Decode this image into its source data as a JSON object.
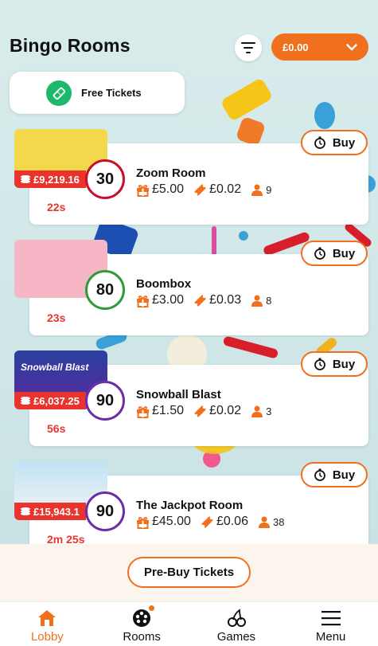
{
  "header": {
    "title": "Bingo Rooms",
    "balance": "£0.00"
  },
  "free_tickets": {
    "label": "Free Tickets"
  },
  "rooms": [
    {
      "name": "Zoom Room",
      "jackpot": "£9,219.16",
      "ball": "30",
      "ball_color": "#c8102e",
      "timer": "22s",
      "ticket_price": "£5.00",
      "ticket_cost": "£0.02",
      "players": "9",
      "buy_label": "Buy"
    },
    {
      "name": "Boombox",
      "jackpot": "",
      "ball": "80",
      "ball_color": "#2f9a3a",
      "timer": "23s",
      "ticket_price": "£3.00",
      "ticket_cost": "£0.03",
      "players": "8",
      "buy_label": "Buy"
    },
    {
      "name": "Snowball Blast",
      "jackpot": "£6,037.25",
      "ball": "90",
      "ball_color": "#6a2fa8",
      "timer": "56s",
      "ticket_price": "£1.50",
      "ticket_cost": "£0.02",
      "players": "3",
      "buy_label": "Buy",
      "thumb_text": "Snowball Blast"
    },
    {
      "name": "The Jackpot Room",
      "jackpot": "£15,943.1",
      "ball": "90",
      "ball_color": "#6a2fa8",
      "timer": "2m 25s",
      "ticket_price": "£45.00",
      "ticket_cost": "£0.06",
      "players": "38",
      "buy_label": "Buy"
    }
  ],
  "prebuy": {
    "label": "Pre-Buy Tickets"
  },
  "nav": {
    "items": [
      {
        "label": "Lobby",
        "icon": "home-icon",
        "active": true
      },
      {
        "label": "Rooms",
        "icon": "bingo-ball-icon"
      },
      {
        "label": "Games",
        "icon": "cherries-icon"
      },
      {
        "label": "Menu",
        "icon": "menu-icon"
      }
    ]
  },
  "colors": {
    "accent": "#f0701e",
    "jackpot": "#e8342d",
    "success": "#1db86a"
  }
}
